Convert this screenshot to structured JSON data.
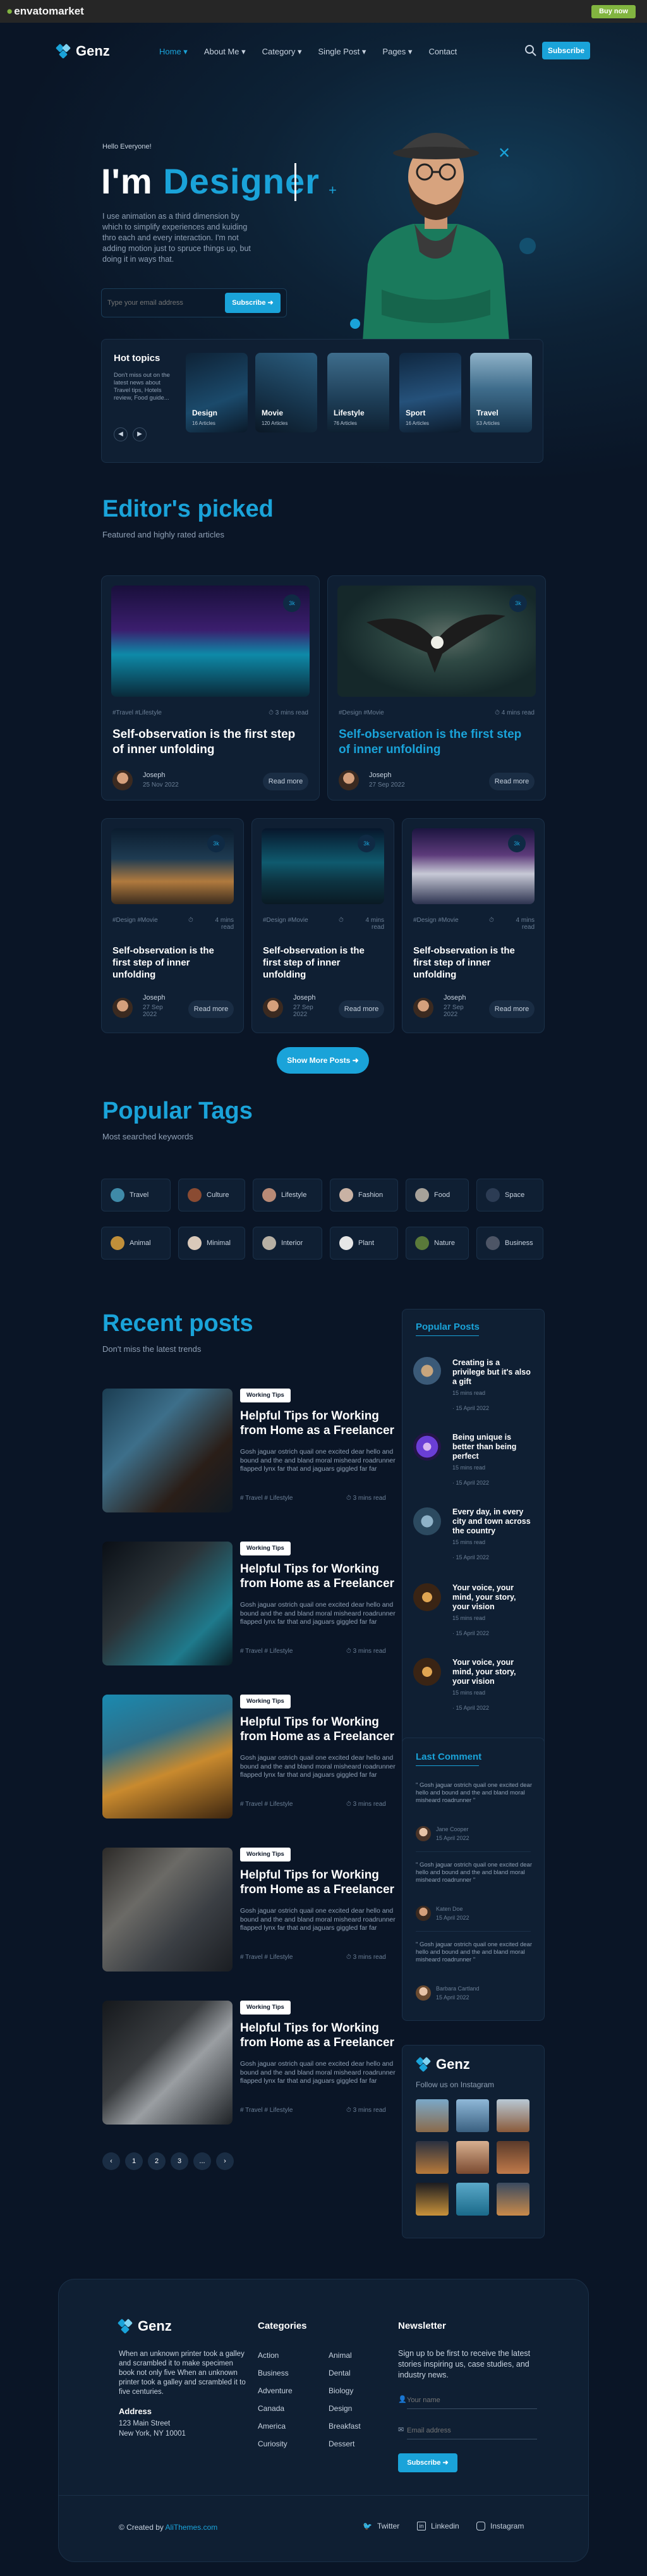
{
  "envato": {
    "logo": "envatomarket",
    "buy": "Buy now"
  },
  "brand": {
    "name": "Genz"
  },
  "nav": {
    "items": [
      "Home",
      "About Me",
      "Category",
      "Single Post",
      "Pages",
      "Contact"
    ],
    "subscribe": "Subscribe"
  },
  "hero": {
    "hello": "Hello Everyone!",
    "headline_a": "I'm",
    "headline_b": "Designer",
    "desc": "I use animation as a third dimension by which to simplify experiences and kuiding thro each and every interaction. I'm not adding motion just to spruce things up, but doing it in ways that.",
    "email_placeholder": "Type your email address",
    "subscribe": "Subscribe"
  },
  "hot": {
    "title": "Hot topics",
    "desc": "Don't miss out on the latest news about Travel tips, Hotels review, Food guide...",
    "topics": [
      {
        "name": "Design",
        "count": "16 Articles"
      },
      {
        "name": "Movie",
        "count": "120 Articles"
      },
      {
        "name": "Lifestyle",
        "count": "76 Articles"
      },
      {
        "name": "Sport",
        "count": "16 Articles"
      },
      {
        "name": "Travel",
        "count": "53 Articles"
      }
    ]
  },
  "editors": {
    "title": "Editor's picked",
    "sub": "Featured and highly rated articles",
    "big": [
      {
        "cats": "#Travel #Lifestyle",
        "read": "3 mins read",
        "title": "Self-observation is the first step of inner unfolding",
        "author": "Joseph",
        "date": "25 Nov 2022",
        "readmore": "Read more",
        "badge": "3k"
      },
      {
        "cats": "#Design #Movie",
        "read": "4 mins read",
        "title": "Self-observation is the first step of inner unfolding",
        "author": "Joseph",
        "date": "27 Sep 2022",
        "readmore": "Read more",
        "badge": "3k"
      }
    ],
    "small": [
      {
        "cats": "#Design #Movie",
        "read": "4 mins read",
        "title": "Self-observation is the first step of inner unfolding",
        "author": "Joseph",
        "date": "27 Sep 2022",
        "readmore": "Read more",
        "badge": "3k"
      },
      {
        "cats": "#Design #Movie",
        "read": "4 mins read",
        "title": "Self-observation is the first step of inner unfolding",
        "author": "Joseph",
        "date": "27 Sep 2022",
        "readmore": "Read more",
        "badge": "3k"
      },
      {
        "cats": "#Design #Movie",
        "read": "4 mins read",
        "title": "Self-observation is the first step of inner unfolding",
        "author": "Joseph",
        "date": "27 Sep 2022",
        "readmore": "Read more",
        "badge": "3k"
      }
    ],
    "show_more": "Show More Posts"
  },
  "tags": {
    "title": "Popular Tags",
    "sub": "Most searched keywords",
    "row1": [
      "Travel",
      "Culture",
      "Lifestyle",
      "Fashion",
      "Food",
      "Space"
    ],
    "row2": [
      "Animal",
      "Minimal",
      "Interior",
      "Plant",
      "Nature",
      "Business"
    ]
  },
  "recent": {
    "title": "Recent posts",
    "sub": "Don't miss the latest trends",
    "posts": [
      {
        "badge": "Working Tips",
        "title": "Helpful Tips for Working from Home as a Freelancer",
        "excerpt": "Gosh jaguar ostrich quail one excited dear hello and bound and the and bland moral misheard roadrunner flapped lynx far that and jaguars giggled far far",
        "tags": "# Travel  # Lifestyle",
        "read": "3 mins read"
      },
      {
        "badge": "Working Tips",
        "title": "Helpful Tips for Working from Home as a Freelancer",
        "excerpt": "Gosh jaguar ostrich quail one excited dear hello and bound and the and bland moral misheard roadrunner flapped lynx far that and jaguars giggled far far",
        "tags": "# Travel  # Lifestyle",
        "read": "3 mins read"
      },
      {
        "badge": "Working Tips",
        "title": "Helpful Tips for Working from Home as a Freelancer",
        "excerpt": "Gosh jaguar ostrich quail one excited dear hello and bound and the and bland moral misheard roadrunner flapped lynx far that and jaguars giggled far far",
        "tags": "# Travel  # Lifestyle",
        "read": "3 mins read"
      },
      {
        "badge": "Working Tips",
        "title": "Helpful Tips for Working from Home as a Freelancer",
        "excerpt": "Gosh jaguar ostrich quail one excited dear hello and bound and the and bland moral misheard roadrunner flapped lynx far that and jaguars giggled far far",
        "tags": "# Travel  # Lifestyle",
        "read": "3 mins read"
      },
      {
        "badge": "Working Tips",
        "title": "Helpful Tips for Working from Home as a Freelancer",
        "excerpt": "Gosh jaguar ostrich quail one excited dear hello and bound and the and bland moral misheard roadrunner flapped lynx far that and jaguars giggled far far",
        "tags": "# Travel  # Lifestyle",
        "read": "3 mins read"
      }
    ],
    "pages": [
      "1",
      "2",
      "3",
      "..."
    ]
  },
  "popular_posts": {
    "title": "Popular Posts",
    "items": [
      {
        "title": "Creating is a privilege but it's also a gift",
        "read": "15 mins read",
        "date": "15 April 2022"
      },
      {
        "title": "Being unique is better than being perfect",
        "read": "15 mins read",
        "date": "15 April 2022"
      },
      {
        "title": "Every day, in every city and town across the country",
        "read": "15 mins read",
        "date": "15 April 2022"
      },
      {
        "title": "Your voice, your mind, your story, your vision",
        "read": "15 mins read",
        "date": "15 April 2022"
      },
      {
        "title": "Your voice, your mind, your story, your vision",
        "read": "15 mins read",
        "date": "15 April 2022"
      }
    ]
  },
  "last_comment": {
    "title": "Last Comment",
    "items": [
      {
        "quote": "\" Gosh jaguar ostrich quail one excited dear hello and bound and the and bland moral misheard roadrunner \"",
        "name": "Jane Cooper",
        "date": "15 April 2022"
      },
      {
        "quote": "\" Gosh jaguar ostrich quail one excited dear hello and bound and the and bland moral misheard roadrunner \"",
        "name": "Katen Doe",
        "date": "15 April 2022"
      },
      {
        "quote": "\" Gosh jaguar ostrich quail one excited dear hello and bound and the and bland moral misheard roadrunner \"",
        "name": "Barbara Cartland",
        "date": "15 April 2022"
      }
    ]
  },
  "instagram": {
    "brand": "Genz",
    "follow": "Follow us on Instagram"
  },
  "footer": {
    "brand": "Genz",
    "about": "When an unknown printer took a galley and scrambled it to make specimen book not only five When an unknown printer took a galley and scrambled it to five centuries.",
    "address_title": "Address",
    "address1": "123 Main Street",
    "address2": "New York, NY 10001",
    "categories_title": "Categories",
    "cat_col1": [
      "Action",
      "Business",
      "Adventure",
      "Canada",
      "America",
      "Curiosity"
    ],
    "cat_col2": [
      "Animal",
      "Dental",
      "Biology",
      "Design",
      "Breakfast",
      "Dessert"
    ],
    "newsletter_title": "Newsletter",
    "newsletter_text": "Sign up to be first to receive the latest stories inspiring us, case studies, and industry news.",
    "name_placeholder": "Your name",
    "email_placeholder": "Email address",
    "subscribe": "Subscribe",
    "copyright": "© Created by",
    "creator": "AliThemes.com",
    "socials": [
      "Twitter",
      "Linkedin",
      "Instagram"
    ]
  },
  "colors": {
    "accent": "#1aa3d9",
    "background": "#0a1526",
    "card": "#0f1f33",
    "envato_green": "#82b540"
  }
}
